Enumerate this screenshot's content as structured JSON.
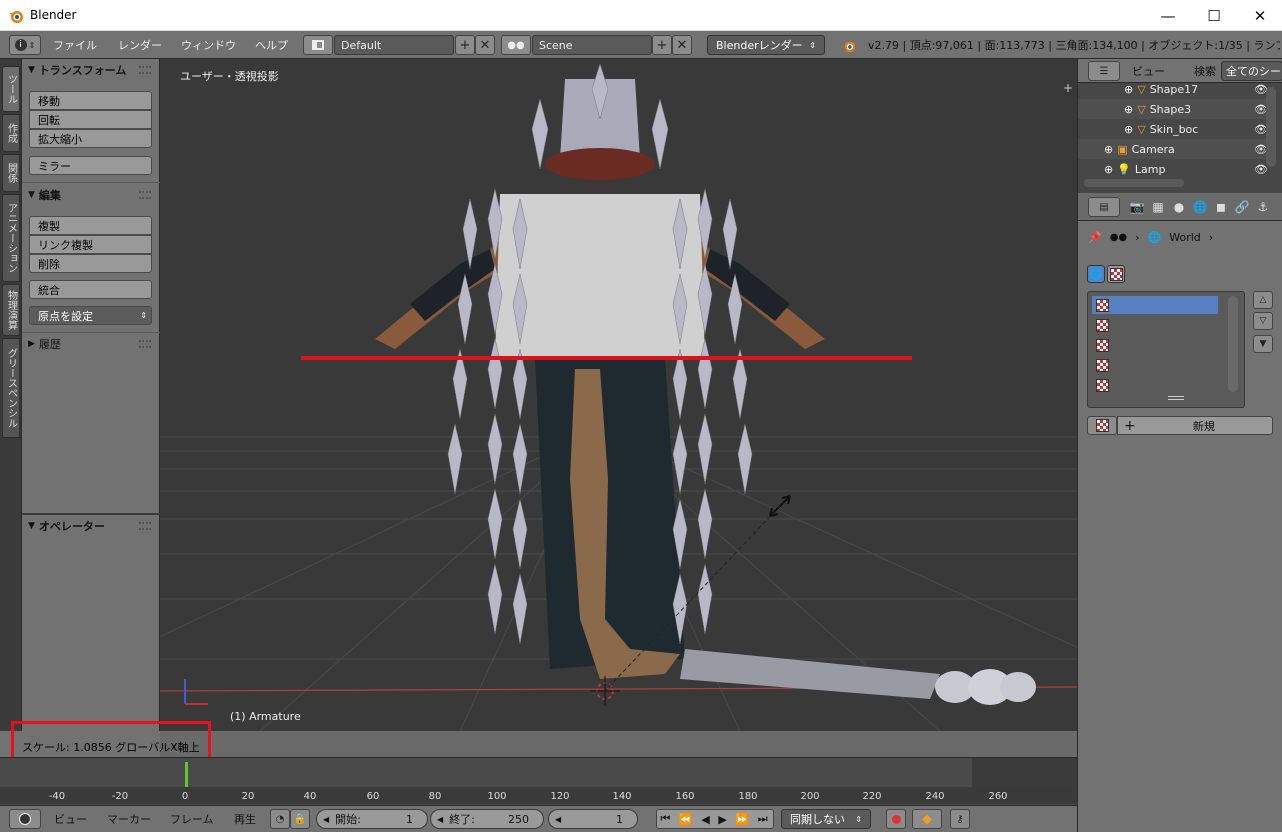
{
  "window": {
    "title": "Blender",
    "min": "—",
    "max": "☐",
    "close": "✕"
  },
  "menu": {
    "file": "ファイル",
    "render": "レンダー",
    "window": "ウィンドウ",
    "help": "ヘルプ"
  },
  "screen": {
    "layout": "Default",
    "scene": "Scene",
    "engine": "Blenderレンダー"
  },
  "stats": "v2.79 | 頂点:97,061 | 面:113,773 | 三角面:134,100 | オブジェクト:1/35 | ランプ:",
  "tabs": [
    "ツール",
    "作成",
    "関係",
    "アニメーション",
    "物理演算",
    "グリースペンシル"
  ],
  "toolshelf": {
    "transform_title": "トランスフォーム",
    "move": "移動",
    "rotate": "回転",
    "scale": "拡大縮小",
    "mirror": "ミラー",
    "edit_title": "編集",
    "duplicate": "複製",
    "link_duplicate": "リンク複製",
    "delete": "削除",
    "join": "統合",
    "set_origin": "原点を設定",
    "history_title": "履歴",
    "operator_title": "オペレーター"
  },
  "viewport": {
    "label": "ユーザー・透視投影",
    "object": "(1) Armature"
  },
  "status": "スケール: 1.0856 グローバルX軸上",
  "timeline": {
    "ticks": [
      "-40",
      "-20",
      "0",
      "20",
      "40",
      "60",
      "80",
      "100",
      "120",
      "140",
      "160",
      "180",
      "200",
      "220",
      "240",
      "260"
    ],
    "view": "ビュー",
    "marker": "マーカー",
    "frame": "フレーム",
    "play": "再生",
    "start_label": "開始:",
    "start_value": "1",
    "end_label": "終了:",
    "end_value": "250",
    "current": "1",
    "sync": "同期しない"
  },
  "outliner": {
    "view": "ビュー",
    "search": "検索",
    "filter": "全てのシー",
    "rows": [
      "Shape17",
      "Shape3",
      "Skin_boc",
      "Camera",
      "Lamp"
    ]
  },
  "properties": {
    "breadcrumb": "World",
    "new_button": "新規"
  }
}
